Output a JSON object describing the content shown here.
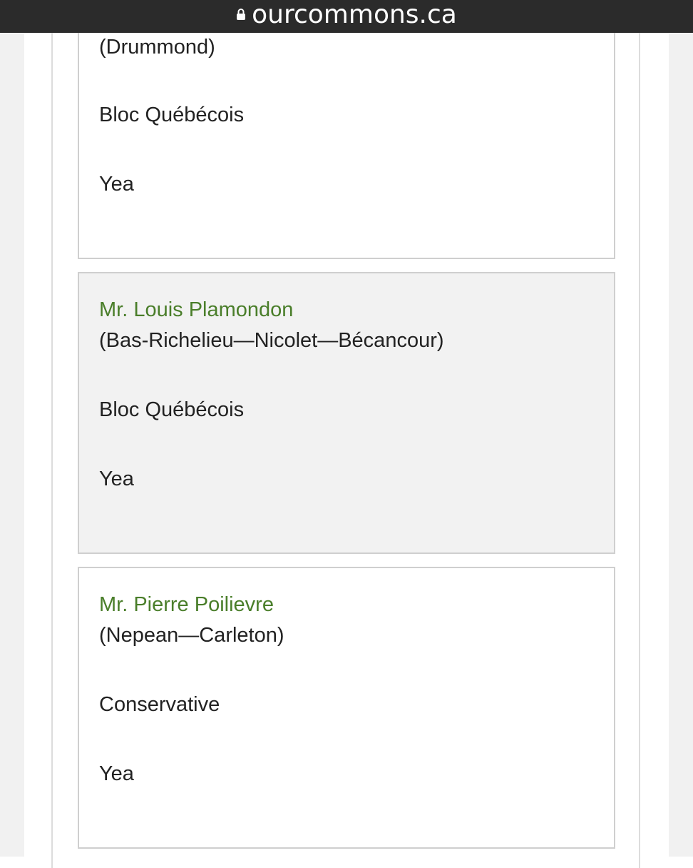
{
  "browser": {
    "url": "ourcommons.ca"
  },
  "votes": [
    {
      "member": "",
      "riding": "(Drummond)",
      "party": "Bloc Québécois",
      "vote": "Yea"
    },
    {
      "member": "Mr. Louis Plamondon",
      "riding": "(Bas-Richelieu—Nicolet—Bécancour)",
      "party": "Bloc Québécois",
      "vote": "Yea"
    },
    {
      "member": "Mr. Pierre Poilievre",
      "riding": "(Nepean—Carleton)",
      "party": "Conservative",
      "vote": "Yea"
    }
  ]
}
